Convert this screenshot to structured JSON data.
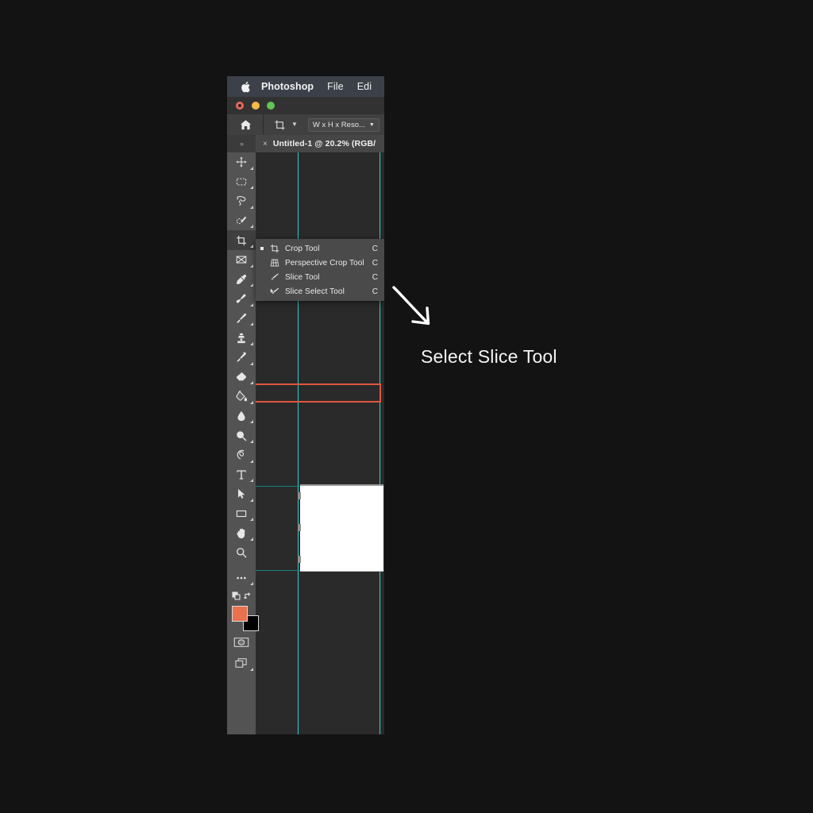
{
  "app": {
    "name": "Photoshop",
    "menubar": {
      "apple_icon": "apple-logo-icon",
      "items": [
        {
          "label": "Photoshop",
          "bold": true
        },
        {
          "label": "File",
          "bold": false
        },
        {
          "label": "Edi",
          "bold": false
        }
      ]
    },
    "window_controls": {
      "close": "close-traffic-light",
      "minimize": "minimize-traffic-light",
      "zoom": "zoom-traffic-light",
      "colors": {
        "close": "#e8685d",
        "minimize": "#f2bb46",
        "zoom": "#62c554"
      }
    },
    "options_bar": {
      "home_icon": "home-icon",
      "tool_icon": "crop-tool-icon",
      "tool_caret": "chevron-down-icon",
      "preset_value": "W x H x Reso...",
      "preset_caret": "chevron-down-icon"
    },
    "tool_panel_header": {
      "expand_label": "»"
    },
    "document_tab": {
      "close_label": "×",
      "title": "Untitled‑1 @ 20.2% (RGB/"
    }
  },
  "toolbar": {
    "tools": [
      {
        "name": "move-tool",
        "icon": "move-icon",
        "active": false
      },
      {
        "name": "rectangular-marquee-tool",
        "icon": "marquee-icon",
        "active": false
      },
      {
        "name": "lasso-tool",
        "icon": "lasso-icon",
        "active": false
      },
      {
        "name": "object-selection-tool",
        "icon": "quick-selection-icon",
        "active": false
      },
      {
        "name": "crop-tool",
        "icon": "crop-icon",
        "active": true
      },
      {
        "name": "frame-tool",
        "icon": "frame-icon",
        "active": false
      },
      {
        "name": "eyedropper-tool",
        "icon": "eyedropper-icon",
        "active": false
      },
      {
        "name": "spot-healing-brush-tool",
        "icon": "healing-brush-icon",
        "active": false
      },
      {
        "name": "brush-tool",
        "icon": "brush-icon",
        "active": false
      },
      {
        "name": "clone-stamp-tool",
        "icon": "clone-stamp-icon",
        "active": false
      },
      {
        "name": "history-brush-tool",
        "icon": "history-brush-icon",
        "active": false
      },
      {
        "name": "eraser-tool",
        "icon": "eraser-icon",
        "active": false
      },
      {
        "name": "gradient-tool",
        "icon": "paint-bucket-icon",
        "active": false
      },
      {
        "name": "blur-tool",
        "icon": "blur-droplet-icon",
        "active": false
      },
      {
        "name": "dodge-tool",
        "icon": "dodge-icon",
        "active": false
      },
      {
        "name": "pen-tool",
        "icon": "pen-icon",
        "active": false
      },
      {
        "name": "type-tool",
        "icon": "type-icon",
        "active": false
      },
      {
        "name": "path-selection-tool",
        "icon": "path-arrow-icon",
        "active": false
      },
      {
        "name": "rectangle-tool",
        "icon": "rectangle-icon",
        "active": false
      },
      {
        "name": "hand-tool",
        "icon": "hand-icon",
        "active": false
      },
      {
        "name": "zoom-tool",
        "icon": "magnifier-icon",
        "active": false
      },
      {
        "name": "edit-toolbar-button",
        "icon": "ellipsis-icon",
        "active": false
      }
    ],
    "swap_icon": "default-colors-icon",
    "swap_arrows_icon": "swap-colors-icon",
    "foreground_color": "#e8714f",
    "background_color": "#000000",
    "quick_mask_icon": "quick-mask-icon",
    "screen_mode_icon": "screen-mode-icon"
  },
  "tool_flyout": {
    "items": [
      {
        "label": "Crop Tool",
        "shortcut": "C",
        "icon": "crop-icon",
        "selected": true
      },
      {
        "label": "Perspective Crop Tool",
        "shortcut": "C",
        "icon": "perspective-crop-icon",
        "selected": false
      },
      {
        "label": "Slice Tool",
        "shortcut": "C",
        "icon": "slice-icon",
        "selected": false
      },
      {
        "label": "Slice Select Tool",
        "shortcut": "C",
        "icon": "slice-select-icon",
        "selected": false
      }
    ]
  },
  "canvas": {
    "guide_color": "#2fd0d0",
    "selection_color": "#e0573c",
    "artboard_color": "#ffffff",
    "background_color": "#2a2a2a"
  },
  "annotation": {
    "arrow": "curved-arrow-icon",
    "text": "Select Slice Tool",
    "text_color": "#f4f4f4"
  },
  "page": {
    "background_color": "#131313"
  }
}
